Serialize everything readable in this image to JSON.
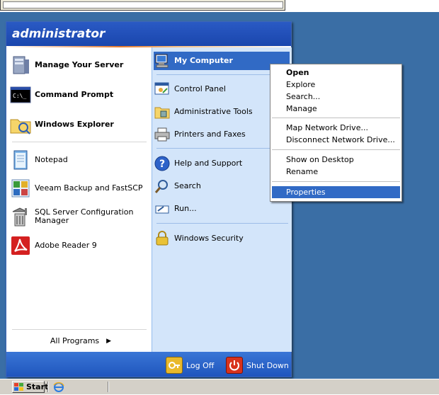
{
  "start_menu": {
    "user": "administrator",
    "pinned": [
      {
        "label": "Manage Your Server",
        "icon": "server-icon"
      },
      {
        "label": "Command Prompt",
        "icon": "command-prompt-icon"
      },
      {
        "label": "Windows Explorer",
        "icon": "folder-explorer-icon"
      }
    ],
    "recent": [
      {
        "label": "Notepad",
        "icon": "notepad-icon"
      },
      {
        "label": "Veeam Backup and FastSCP",
        "icon": "veeam-icon"
      },
      {
        "label": "SQL Server Configuration Manager",
        "icon": "sql-config-icon"
      },
      {
        "label": "Adobe Reader 9",
        "icon": "adobe-reader-icon"
      }
    ],
    "all_programs": "All Programs",
    "right": [
      {
        "label": "My Computer",
        "icon": "my-computer-icon"
      },
      {
        "label": "Control Panel",
        "icon": "control-panel-icon"
      },
      {
        "label": "Administrative Tools",
        "icon": "admin-tools-icon"
      },
      {
        "label": "Printers and Faxes",
        "icon": "printer-icon"
      },
      {
        "label": "Help and Support",
        "icon": "help-icon"
      },
      {
        "label": "Search",
        "icon": "search-icon"
      },
      {
        "label": "Run...",
        "icon": "run-icon"
      },
      {
        "label": "Windows Security",
        "icon": "lock-icon"
      }
    ],
    "log_off": "Log Off",
    "shut_down": "Shut Down"
  },
  "context_menu": {
    "items": [
      {
        "label": "Open"
      },
      {
        "label": "Explore"
      },
      {
        "label": "Search..."
      },
      {
        "label": "Manage"
      },
      {
        "label": "Map Network Drive..."
      },
      {
        "label": "Disconnect Network Drive..."
      },
      {
        "label": "Show on Desktop"
      },
      {
        "label": "Rename"
      },
      {
        "label": "Properties"
      }
    ]
  },
  "taskbar": {
    "start_label": "Start"
  }
}
